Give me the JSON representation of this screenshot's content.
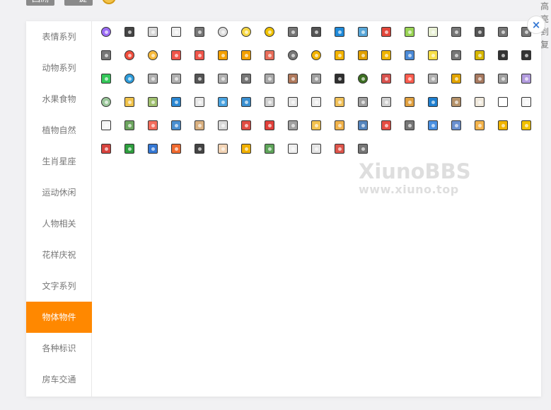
{
  "top": {
    "left_button": "回溯",
    "right_button": "一键"
  },
  "side_text": "高亮到复",
  "categories": [
    {
      "label": "表情系列",
      "active": false
    },
    {
      "label": "动物系列",
      "active": false
    },
    {
      "label": "水果食物",
      "active": false
    },
    {
      "label": "植物自然",
      "active": false
    },
    {
      "label": "生肖星座",
      "active": false
    },
    {
      "label": "运动休闲",
      "active": false
    },
    {
      "label": "人物相关",
      "active": false
    },
    {
      "label": "花样庆祝",
      "active": false
    },
    {
      "label": "文字系列",
      "active": false
    },
    {
      "label": "物体物件",
      "active": true
    },
    {
      "label": "各种标识",
      "active": false
    },
    {
      "label": "房车交通",
      "active": false
    }
  ],
  "emoji_colors": [
    "#9b6cf5",
    "#444444",
    "#d7d7d7",
    "#eeeeee",
    "#777777",
    "#dddddd",
    "#f7d845",
    "#f0c200",
    "#777777",
    "#555555",
    "#1f8ad9",
    "#58a6d8",
    "#e2473b",
    "#9ad455",
    "#e8f0d4",
    "#777777",
    "#555555",
    "#777777",
    "#777777",
    "#777777",
    "#f04d3c",
    "#f6b93b",
    "#ef554a",
    "#ef554a",
    "#f4a000",
    "#f4a000",
    "#e86d5a",
    "#777777",
    "#f3b300",
    "#f3b300",
    "#e0a000",
    "#f0b400",
    "#4b8ad7",
    "#f7df49",
    "#777777",
    "#d6b600",
    "#333333",
    "#333333",
    "#34c759",
    "#2d9cdb",
    "#b0b0b0",
    "#b0b0b0",
    "#555555",
    "#b0b0b0",
    "#777777",
    "#aaaaaa",
    "#b07a5d",
    "#a0a0a0",
    "#2f2f2f",
    "#3d6f22",
    "#d9534f",
    "#ff5d4f",
    "#b0b0b0",
    "#e3a500",
    "#a87a60",
    "#a0a0a0",
    "#b39cdf",
    "#9ac69a",
    "#f0c24a",
    "#a0c070",
    "#2b87d2",
    "#e8e8e8",
    "#4aa3e0",
    "#3a8fd0",
    "#d0d0d0",
    "#e6e6e6",
    "#ececec",
    "#f1c15a",
    "#a0a0a0",
    "#d0d0d0",
    "#e0a040",
    "#1f7fcf",
    "#b5926a",
    "#f0e9dc",
    "#ffffff",
    "#f6f6f6",
    "#f6f6f6",
    "#6da55f",
    "#f36d5d",
    "#4a8fd0",
    "#d9b080",
    "#d9d9d9",
    "#e04c43",
    "#e1403a",
    "#a0a0a0",
    "#f3c24f",
    "#f0b24a",
    "#5585bd",
    "#e54d42",
    "#777777",
    "#4a90e2",
    "#6a90d0",
    "#f3b34b",
    "#f0b400",
    "#f0c000",
    "#d7433e",
    "#2e9f3e",
    "#3578d4",
    "#f06a2f",
    "#444444",
    "#f2d4b6",
    "#f1b000",
    "#5fa55a",
    "#eeeeee",
    "#e5e5e5",
    "#de554b",
    "#777777"
  ],
  "watermark": {
    "title": "XiunoBBS",
    "subtitle": "www.xiuno.top"
  },
  "close_label": "×"
}
